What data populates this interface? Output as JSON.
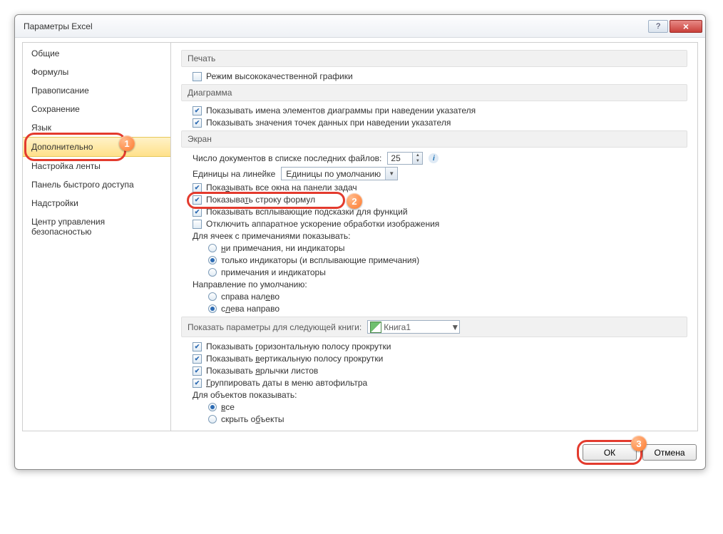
{
  "window": {
    "title": "Параметры Excel"
  },
  "sidebar": {
    "items": [
      "Общие",
      "Формулы",
      "Правописание",
      "Сохранение",
      "Язык",
      "Дополнительно",
      "Настройка ленты",
      "Панель быстрого доступа",
      "Надстройки",
      "Центр управления безопасностью"
    ],
    "selectedIndex": 5
  },
  "sections": {
    "print": {
      "head": "Печать",
      "hq": "Режим высококачественной графики"
    },
    "chart": {
      "head": "Диаграмма",
      "showNames": "Показывать имена элементов диаграммы при наведении указателя",
      "showValues": "Показывать значения точек данных при наведении указателя"
    },
    "screen": {
      "head": "Экран",
      "recentLabel": "Число документов в списке последних файлов:",
      "recentValue": "25",
      "rulerLabel": "Единицы на линейке",
      "rulerValue": "Единицы по умолчанию",
      "showWindows": "Показывать все окна на панели задач",
      "showFormulaBar": "Показывать строку формул",
      "showTooltips": "Показывать всплывающие подсказки для функций",
      "disableHardware": "Отключить аппаратное ускорение обработки изображения",
      "commentsHead": "Для ячеек с примечаниями показывать:",
      "commentsOpt1": "ни примечания, ни индикаторы",
      "commentsOpt2": "только индикаторы (и всплывающие примечания)",
      "commentsOpt3": "примечания и индикаторы",
      "dirHead": "Направление по умолчанию:",
      "dirRtl": "справа налево",
      "dirLtr": "слева направо"
    },
    "book": {
      "head": "Показать параметры для следующей книги:",
      "name": "Книга1",
      "hscroll": "Показывать горизонтальную полосу прокрутки",
      "vscroll": "Показывать вертикальную полосу прокрутки",
      "tabs": "Показывать ярлычки листов",
      "groupDates": "Группировать даты в меню автофильтра",
      "objHead": "Для объектов показывать:",
      "objAll": "все",
      "objHide": "скрыть объекты"
    }
  },
  "footer": {
    "ok": "ОК",
    "cancel": "Отмена"
  },
  "badges": {
    "b1": "1",
    "b2": "2",
    "b3": "3"
  }
}
